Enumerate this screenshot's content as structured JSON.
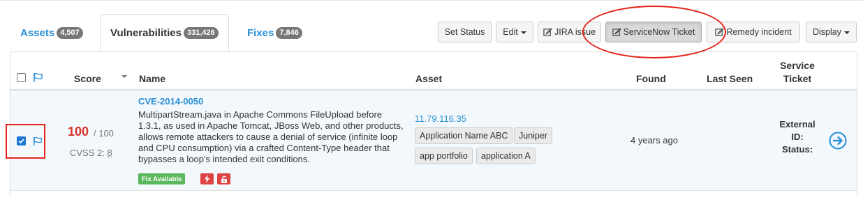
{
  "tabs": [
    {
      "label": "Assets",
      "count": "4,507",
      "active": false
    },
    {
      "label": "Vulnerabilities",
      "count": "331,426",
      "active": true
    },
    {
      "label": "Fixes",
      "count": "7,846",
      "active": false
    }
  ],
  "toolbar": {
    "set_status": "Set Status",
    "edit": "Edit",
    "jira": "JIRA issue",
    "servicenow": "ServiceNow Ticket",
    "remedy": "Remedy incident",
    "display": "Display"
  },
  "table": {
    "headers": {
      "score": "Score",
      "name": "Name",
      "asset": "Asset",
      "found": "Found",
      "last_seen": "Last Seen",
      "service_ticket_line1": "Service",
      "service_ticket_line2": "Ticket"
    },
    "rows": [
      {
        "checked": true,
        "score": "100",
        "score_max": "/ 100",
        "cvss_label": "CVSS 2:",
        "cvss_value": "8",
        "cve_id": "CVE-2014-0050",
        "description": "MultipartStream.java in Apache Commons FileUpload before 1.3.1, as used in Apache Tomcat, JBoss Web, and other products, allows remote attackers to cause a denial of service (infinite loop and CPU consumption) via a crafted Content-Type header that bypasses a loop's intended exit conditions.",
        "fix_badge": "Fix Available",
        "asset_ip": "11.79.116.35",
        "tags": [
          "Application Name ABC",
          "Juniper",
          "app portfolio",
          "application A"
        ],
        "found": "4 years ago",
        "last_seen": "",
        "external_id_label": "External ID:",
        "status_label": "Status:"
      }
    ]
  },
  "colors": {
    "link": "#2a8fd6",
    "score": "#d9332b",
    "fix": "#5cb85c",
    "danger": "#e04343",
    "annotation": "#e5231a"
  },
  "icons": [
    "flag-icon",
    "edit-icon",
    "caret-down-icon",
    "lightning-icon",
    "unlock-icon",
    "arrow-right-circle-icon",
    "sort-desc-icon"
  ]
}
